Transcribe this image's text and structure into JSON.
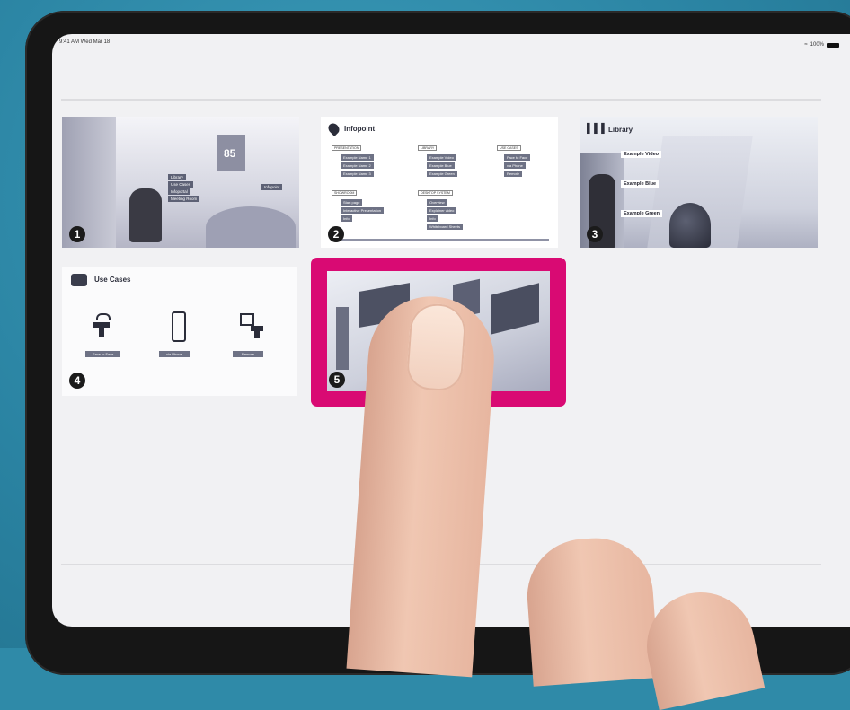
{
  "status_bar": {
    "time": "9:41 AM  Wed Mar 18",
    "battery": "100%"
  },
  "tiles": [
    {
      "number": "1",
      "tags": [
        "Library",
        "Use Cases",
        "Infoportal",
        "Meeting Room"
      ],
      "label_right": "Infopoint",
      "screen_text": "85"
    },
    {
      "number": "2",
      "title": "Infopoint",
      "sections": [
        {
          "header": "PRESENTATION",
          "items": [
            "Example Name 1",
            "Example Name 2",
            "Example Name 3"
          ]
        },
        {
          "header": "LIBRARY",
          "items": [
            "Example Video",
            "Example Blue",
            "Example Green"
          ]
        },
        {
          "header": "USE CASES",
          "items": [
            "Face to Face",
            "via Phone",
            "Remote"
          ]
        },
        {
          "header": "SHOWROOM",
          "items": [
            "Start page",
            "Interactive Presentation",
            "Info"
          ]
        },
        {
          "header": "DESKTOP SYSTEM",
          "items": [
            "Overview",
            "Explainer video",
            "Info",
            "Whiteboard Sheets"
          ]
        }
      ]
    },
    {
      "number": "3",
      "title": "Library",
      "labels": [
        "Example Video",
        "Example Blue",
        "Example Green"
      ]
    },
    {
      "number": "4",
      "title": "Use Cases",
      "options": [
        "Face to Face",
        "via Phone",
        "Remote"
      ]
    },
    {
      "number": "5"
    }
  ],
  "colors": {
    "accent": "#d90a73",
    "background": "#2f8aa8",
    "screen": "#f1f1f3"
  }
}
